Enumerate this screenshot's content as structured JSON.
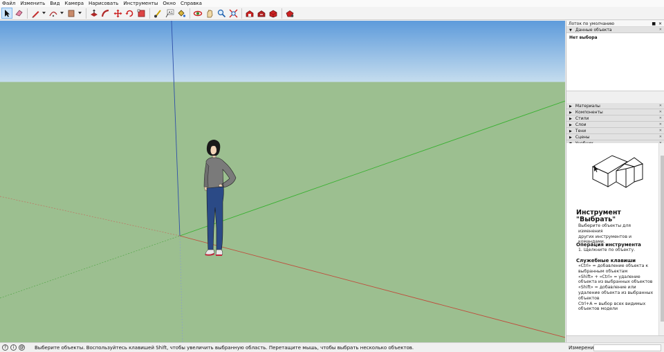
{
  "menu": [
    "Файл",
    "Изменить",
    "Вид",
    "Камера",
    "Нарисовать",
    "Инструменты",
    "Окно",
    "Справка"
  ],
  "toolbar": {
    "tools": [
      "select-arrow-icon",
      "eraser-icon",
      "pencil-icon",
      "arc-icon",
      "rectangle-icon",
      "push-pull-icon",
      "follow-me-icon",
      "move-icon",
      "rotate-icon",
      "scale-icon",
      "tape-measure-icon",
      "text-icon",
      "paint-bucket-icon",
      "orbit-icon",
      "pan-icon",
      "zoom-icon",
      "zoom-extents-icon",
      "warehouse-icon",
      "extension-warehouse-icon",
      "send-to-layout-icon",
      "extension-manager-icon"
    ]
  },
  "status": {
    "text": "Выберите объекты. Воспользуйтесь клавишей Shift, чтобы увеличить выбранную область. Перетащите мышь, чтобы выбрать несколько объектов.",
    "measure_label": "Измерения",
    "measure_value": ""
  },
  "tray": {
    "title": "Лоток по умолчанию",
    "entity_info": {
      "label": "Данные объекта",
      "value": "Нет выбора"
    },
    "panels": [
      "Материалы",
      "Компоненты",
      "Стили",
      "Слои",
      "Тени",
      "Сцены",
      "Учебник"
    ],
    "tutorial": {
      "title_line1": "Инструмент",
      "title_line2": "\"Выбрать\"",
      "desc": [
        "Выберите объекты для изменения",
        "других инструментов и",
        "командами."
      ],
      "op_heading": "Операция инструмента",
      "op_step": "1. Щелкните по объекту.",
      "keys_heading": "Служебные клавиши",
      "keys": [
        "«Ctrl» = добавление объекта к",
        "выбранным объектам",
        "«Shift» + «Ctrl» = удаление",
        "объекта из выбранных объектов",
        "«Shift» = добавление или",
        "удаление объекта из выбранных",
        "объектов",
        "Ctrl+A = выбор всех видимых",
        "объектов модели"
      ]
    }
  },
  "colors": {
    "sky_top": "#5e9bdb",
    "horizon": "#c4dcee",
    "ground": "#9cbf90",
    "axis_blue": "#2d4ea8",
    "axis_green": "#38b030",
    "axis_red": "#c04a3a"
  }
}
